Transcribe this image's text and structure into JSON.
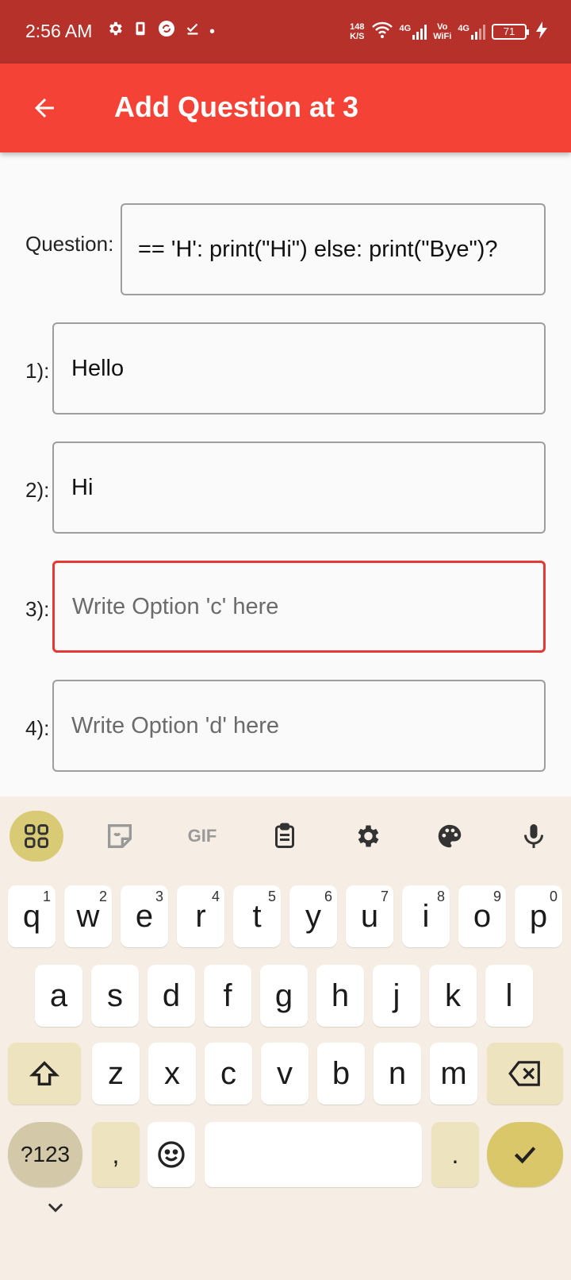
{
  "status_bar": {
    "time": "2:56 AM",
    "net_speed_value": "148",
    "net_speed_unit": "K/S",
    "sig1_label": "4G",
    "sig2_top": "Vo",
    "sig2_bottom": "WiFi",
    "sig3_label": "4G",
    "battery": "71",
    "dot": "•"
  },
  "app_bar": {
    "title": "Add Question at 3"
  },
  "form": {
    "question_label": "Question:",
    "question_value": "== 'H': print(\"Hi\") else: print(\"Bye\")?",
    "options": [
      {
        "label": "1):",
        "value": "Hello",
        "placeholder": ""
      },
      {
        "label": "2):",
        "value": "Hi",
        "placeholder": ""
      },
      {
        "label": "3):",
        "value": "",
        "placeholder": "Write Option 'c' here"
      },
      {
        "label": "4):",
        "value": "",
        "placeholder": "Write Option 'd' here"
      }
    ]
  },
  "keyboard": {
    "toolbar": {
      "gif_label": "GIF"
    },
    "row1": [
      {
        "k": "q",
        "h": "1"
      },
      {
        "k": "w",
        "h": "2"
      },
      {
        "k": "e",
        "h": "3"
      },
      {
        "k": "r",
        "h": "4"
      },
      {
        "k": "t",
        "h": "5"
      },
      {
        "k": "y",
        "h": "6"
      },
      {
        "k": "u",
        "h": "7"
      },
      {
        "k": "i",
        "h": "8"
      },
      {
        "k": "o",
        "h": "9"
      },
      {
        "k": "p",
        "h": "0"
      }
    ],
    "row2": [
      "a",
      "s",
      "d",
      "f",
      "g",
      "h",
      "j",
      "k",
      "l"
    ],
    "row3": [
      "z",
      "x",
      "c",
      "v",
      "b",
      "n",
      "m"
    ],
    "symbols_label": "?123",
    "comma_label": ",",
    "period_label": "."
  },
  "colors": {
    "status_bar": "#b5312a",
    "app_bar": "#f44336",
    "focused_border": "#e53935",
    "keyboard_bg": "#f6eee4",
    "enter_key": "#d9c76a"
  }
}
